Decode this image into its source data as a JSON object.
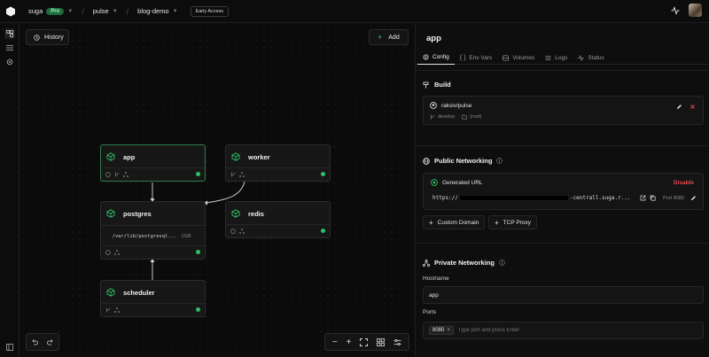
{
  "topbar": {
    "workspace": "suga",
    "plan_badge": "Pro",
    "project": "pulse",
    "environment": "blog-demo",
    "early_access": "Early Access"
  },
  "canvas": {
    "history_label": "History",
    "add_label": "Add",
    "nodes": {
      "app": {
        "name": "app"
      },
      "worker": {
        "name": "worker"
      },
      "postgres": {
        "name": "postgres",
        "volume_path": "/var/lib/postgresql...",
        "volume_size": "1GB"
      },
      "redis": {
        "name": "redis"
      },
      "scheduler": {
        "name": "scheduler"
      }
    },
    "status_color": "#2fbf63"
  },
  "panel": {
    "title": "app",
    "tabs": [
      {
        "label": "Config",
        "icon": "gear-icon",
        "active": true
      },
      {
        "label": "Env Vars",
        "icon": "braces-icon"
      },
      {
        "label": "Volumes",
        "icon": "database-icon"
      },
      {
        "label": "Logs",
        "icon": "list-icon"
      },
      {
        "label": "Status",
        "icon": "pulse-icon"
      }
    ],
    "build": {
      "title": "Build",
      "repo": "raksiv/pulse",
      "branch": "develop",
      "root": "(root)"
    },
    "public_networking": {
      "title": "Public Networking",
      "generated_url_label": "Generated URL",
      "disable_label": "Disable",
      "url_prefix": "https://",
      "url_suffix": "-centrall.suga.r...",
      "port": "Port 8080",
      "custom_domain_label": "Custom Domain",
      "tcp_proxy_label": "TCP Proxy"
    },
    "private_networking": {
      "title": "Private Networking",
      "hostname_label": "Hostname",
      "hostname_value": "app",
      "ports_label": "Ports",
      "port_chip": "8080",
      "ports_placeholder": "Type port and press Enter"
    }
  },
  "colors": {
    "accent_green": "#2fbf63",
    "danger": "#e5484d",
    "selected_border": "#2f7d4f"
  }
}
